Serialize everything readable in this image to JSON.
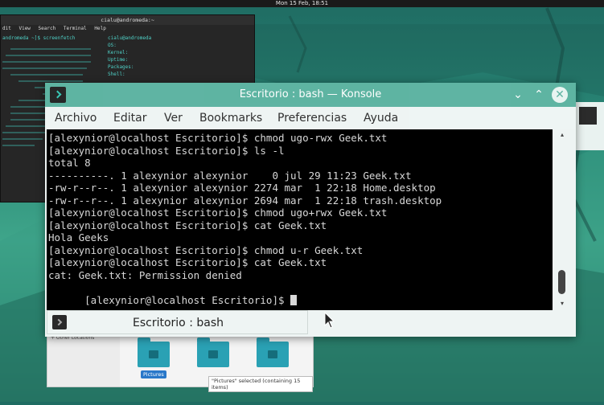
{
  "topbar": {
    "clock": "Mon 15 Feb, 18:51"
  },
  "bg_terminal": {
    "title": "cialu@andromeda:~",
    "menu": [
      "dit",
      "View",
      "Search",
      "Terminal",
      "Help"
    ],
    "prompt": "andromeda ~]$ screenfetch",
    "user_host": "cialu@andromeda",
    "fields": [
      "OS:",
      "Kernel:",
      "Uptime:",
      "Packages:",
      "Shell:"
    ]
  },
  "konsole": {
    "title": "Escritorio : bash — Konsole",
    "menu": [
      "Archivo",
      "Editar",
      "Ver",
      "Bookmarks",
      "Preferencias",
      "Ayuda"
    ],
    "tab_label": "Escritorio : bash",
    "lines": [
      "[alexynior@localhost Escritorio]$ chmod ugo-rwx Geek.txt",
      "[alexynior@localhost Escritorio]$ ls -l",
      "total 8",
      "----------. 1 alexynior alexynior    0 jul 29 11:23 Geek.txt",
      "-rw-r--r--. 1 alexynior alexynior 2274 mar  1 22:18 Home.desktop",
      "-rw-r--r--. 1 alexynior alexynior 2694 mar  1 22:18 trash.desktop",
      "[alexynior@localhost Escritorio]$ chmod ugo+rwx Geek.txt",
      "[alexynior@localhost Escritorio]$ cat Geek.txt",
      "Hola Geeks",
      "[alexynior@localhost Escritorio]$ chmod u-r Geek.txt",
      "[alexynior@localhost Escritorio]$ cat Geek.txt",
      "cat: Geek.txt: Permission denied",
      "[alexynior@localhost Escritorio]$ "
    ]
  },
  "files": {
    "sidebar_item": "+ Other Locations",
    "folders": [
      "Pictures"
    ],
    "status": "\"Pictures\" selected (containing 15 items)"
  },
  "colors": {
    "accent": "#5cb3a1",
    "terminal_bg": "#000000",
    "wallpaper": "#2a8a78"
  }
}
